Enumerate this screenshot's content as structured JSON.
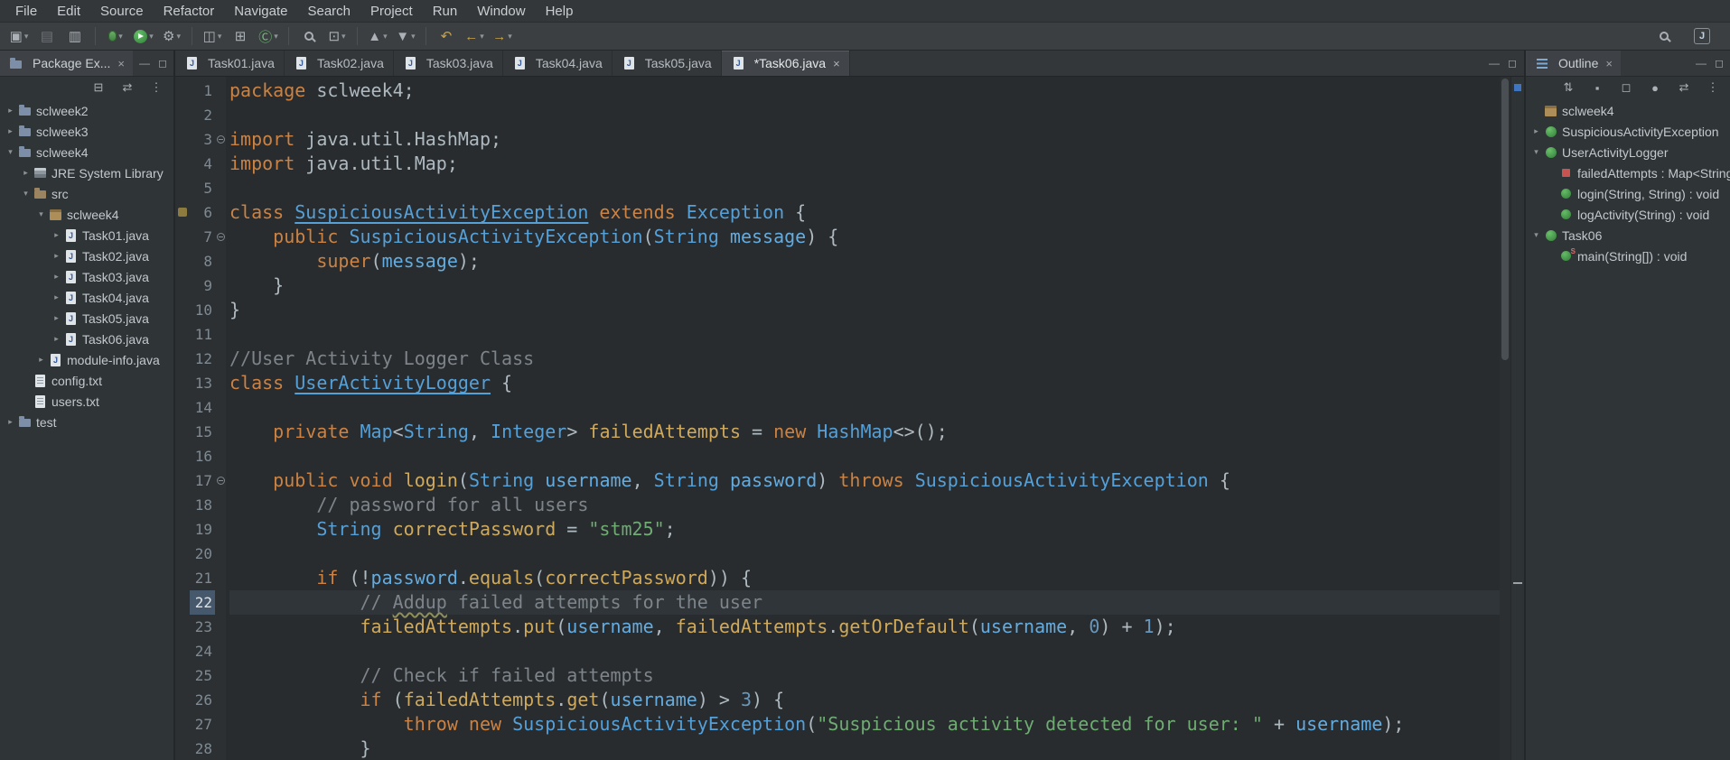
{
  "glyphs": {
    "close": "×",
    "min": "—",
    "max": "◻",
    "dropdown": "▾",
    "arrow_collapsed": "▸",
    "arrow_expanded": "▾"
  },
  "colors": {
    "editor_bg": "#282C2F",
    "keyword": "#CC8242",
    "type": "#56A0D8",
    "member": "#CFA95C",
    "string": "#6FAC72",
    "comment": "#7D848A",
    "number": "#6897BB",
    "current_line_number_bg": "#46586B"
  },
  "menubar": {
    "items": [
      "File",
      "Edit",
      "Source",
      "Refactor",
      "Navigate",
      "Search",
      "Project",
      "Run",
      "Window",
      "Help"
    ]
  },
  "toolbar": {
    "icons": [
      {
        "name": "new-wizard-icon",
        "glyph": "▣",
        "dropdown": true
      },
      {
        "name": "save-icon",
        "glyph": "▤",
        "dim": true
      },
      {
        "name": "print-icon",
        "glyph": "▥"
      },
      {
        "sep": true
      },
      {
        "name": "debug-icon",
        "special": "bug",
        "dropdown": true
      },
      {
        "name": "run-icon",
        "special": "run",
        "dropdown": true
      },
      {
        "name": "external-tools-icon",
        "glyph": "⚙",
        "dropdown": true
      },
      {
        "sep": true
      },
      {
        "name": "new-java-project-icon",
        "glyph": "◫",
        "dropdown": true
      },
      {
        "name": "new-package-icon",
        "glyph": "⊞"
      },
      {
        "name": "new-class-icon",
        "glyph": "Ⓒ",
        "color": "#6FBF73",
        "dropdown": true
      },
      {
        "sep": true
      },
      {
        "name": "search-flashlight-icon",
        "special": "mag"
      },
      {
        "name": "open-task-icon",
        "glyph": "⊡",
        "dropdown": true
      },
      {
        "sep": true
      },
      {
        "name": "previous-annotation-icon",
        "glyph": "▲",
        "dropdown": true
      },
      {
        "name": "next-annotation-icon",
        "glyph": "▼",
        "dropdown": true
      },
      {
        "sep": true
      },
      {
        "name": "last-edit-location-icon",
        "glyph": "↶",
        "color": "#C9A348"
      },
      {
        "name": "back-icon",
        "glyph": "←",
        "color": "#C9A348",
        "dropdown": true
      },
      {
        "name": "forward-icon",
        "glyph": "→",
        "color": "#C9A348",
        "dropdown": true
      }
    ],
    "right_icons": [
      {
        "name": "search-icon",
        "special": "mag"
      },
      {
        "name": "java-perspective-icon",
        "glyph": "J",
        "boxed": true
      }
    ]
  },
  "package_explorer": {
    "tab_label": "Package Ex...",
    "toolbar_icons": [
      {
        "name": "collapse-all-icon",
        "glyph": "⊟"
      },
      {
        "name": "link-with-editor-icon",
        "glyph": "⇄"
      },
      {
        "name": "view-menu-icon",
        "glyph": "⋮"
      }
    ],
    "tree": [
      {
        "label": "sclweek2",
        "depth": 0,
        "icon": "project",
        "arrow": "right"
      },
      {
        "label": "sclweek3",
        "depth": 0,
        "icon": "project",
        "arrow": "right"
      },
      {
        "label": "sclweek4",
        "depth": 0,
        "icon": "project",
        "arrow": "down"
      },
      {
        "label": "JRE System Library",
        "depth": 1,
        "icon": "jre",
        "arrow": "right"
      },
      {
        "label": "src",
        "depth": 1,
        "icon": "srcfolder",
        "arrow": "down"
      },
      {
        "label": "sclweek4",
        "depth": 2,
        "icon": "package",
        "arrow": "down"
      },
      {
        "label": "Task01.java",
        "depth": 3,
        "icon": "jfile",
        "arrow": "right"
      },
      {
        "label": "Task02.java",
        "depth": 3,
        "icon": "jfile",
        "arrow": "right"
      },
      {
        "label": "Task03.java",
        "depth": 3,
        "icon": "jfile",
        "arrow": "right"
      },
      {
        "label": "Task04.java",
        "depth": 3,
        "icon": "jfile",
        "arrow": "right"
      },
      {
        "label": "Task05.java",
        "depth": 3,
        "icon": "jfile",
        "arrow": "right"
      },
      {
        "label": "Task06.java",
        "depth": 3,
        "icon": "jfile",
        "arrow": "right"
      },
      {
        "label": "module-info.java",
        "depth": 2,
        "icon": "jfile",
        "arrow": "right"
      },
      {
        "label": "config.txt",
        "depth": 1,
        "icon": "txt"
      },
      {
        "label": "users.txt",
        "depth": 1,
        "icon": "txt"
      },
      {
        "label": "test",
        "depth": 0,
        "icon": "project",
        "arrow": "right"
      }
    ]
  },
  "editor": {
    "tabs": [
      {
        "label": "Task01.java"
      },
      {
        "label": "Task02.java"
      },
      {
        "label": "Task03.java"
      },
      {
        "label": "Task04.java"
      },
      {
        "label": "Task05.java"
      },
      {
        "label": "Task06.java",
        "active": true,
        "dirty": true
      }
    ],
    "lines": [
      {
        "n": 1,
        "t": [
          [
            "kw",
            "package"
          ],
          [
            "pl",
            " sclweek4;"
          ]
        ]
      },
      {
        "n": 2,
        "t": []
      },
      {
        "n": 3,
        "fold": true,
        "t": [
          [
            "kw",
            "import"
          ],
          [
            "pl",
            " java.util.HashMap;"
          ]
        ]
      },
      {
        "n": 4,
        "t": [
          [
            "kw",
            "import"
          ],
          [
            "pl",
            " java.util.Map;"
          ]
        ]
      },
      {
        "n": 5,
        "t": []
      },
      {
        "n": 6,
        "marker": true,
        "t": [
          [
            "kw",
            "class"
          ],
          [
            "pl",
            " "
          ],
          [
            "tyu",
            "SuspiciousActivityException"
          ],
          [
            "pl",
            " "
          ],
          [
            "kw",
            "extends"
          ],
          [
            "pl",
            " "
          ],
          [
            "ty",
            "Exception"
          ],
          [
            "pl",
            " {"
          ]
        ]
      },
      {
        "n": 7,
        "fold": true,
        "t": [
          [
            "pl",
            "\t"
          ],
          [
            "kw",
            "public"
          ],
          [
            "pl",
            " "
          ],
          [
            "ty",
            "SuspiciousActivityException"
          ],
          [
            "pl",
            "("
          ],
          [
            "ty",
            "String"
          ],
          [
            "pl",
            " "
          ],
          [
            "va",
            "message"
          ],
          [
            "pl",
            ") {"
          ]
        ]
      },
      {
        "n": 8,
        "t": [
          [
            "pl",
            "\t\t"
          ],
          [
            "kw",
            "super"
          ],
          [
            "pl",
            "("
          ],
          [
            "va",
            "message"
          ],
          [
            "pl",
            ");"
          ]
        ]
      },
      {
        "n": 9,
        "t": [
          [
            "pl",
            "\t}"
          ]
        ]
      },
      {
        "n": 10,
        "t": [
          [
            "pl",
            "}"
          ]
        ]
      },
      {
        "n": 11,
        "t": []
      },
      {
        "n": 12,
        "t": [
          [
            "co",
            "//User Activity Logger Class"
          ]
        ]
      },
      {
        "n": 13,
        "t": [
          [
            "kw",
            "class"
          ],
          [
            "pl",
            " "
          ],
          [
            "tyu",
            "UserActivityLogger"
          ],
          [
            "pl",
            " {"
          ]
        ]
      },
      {
        "n": 14,
        "t": []
      },
      {
        "n": 15,
        "t": [
          [
            "pl",
            "\t"
          ],
          [
            "kw",
            "private"
          ],
          [
            "pl",
            " "
          ],
          [
            "ty",
            "Map"
          ],
          [
            "pl",
            "<"
          ],
          [
            "ty",
            "String"
          ],
          [
            "pl",
            ", "
          ],
          [
            "ty",
            "Integer"
          ],
          [
            "pl",
            "> "
          ],
          [
            "me",
            "failedAttempts"
          ],
          [
            "pl",
            " = "
          ],
          [
            "kw",
            "new"
          ],
          [
            "pl",
            " "
          ],
          [
            "ty",
            "HashMap"
          ],
          [
            "pl",
            "<>();"
          ]
        ]
      },
      {
        "n": 16,
        "t": []
      },
      {
        "n": 17,
        "fold": true,
        "t": [
          [
            "pl",
            "\t"
          ],
          [
            "kw",
            "public"
          ],
          [
            "pl",
            " "
          ],
          [
            "kw",
            "void"
          ],
          [
            "pl",
            " "
          ],
          [
            "me",
            "login"
          ],
          [
            "pl",
            "("
          ],
          [
            "ty",
            "String"
          ],
          [
            "pl",
            " "
          ],
          [
            "va",
            "username"
          ],
          [
            "pl",
            ", "
          ],
          [
            "ty",
            "String"
          ],
          [
            "pl",
            " "
          ],
          [
            "va",
            "password"
          ],
          [
            "pl",
            ") "
          ],
          [
            "kw",
            "throws"
          ],
          [
            "pl",
            " "
          ],
          [
            "ty",
            "SuspiciousActivityException"
          ],
          [
            "pl",
            " {"
          ]
        ]
      },
      {
        "n": 18,
        "t": [
          [
            "pl",
            "\t\t"
          ],
          [
            "co",
            "// password for all users"
          ]
        ]
      },
      {
        "n": 19,
        "t": [
          [
            "pl",
            "\t\t"
          ],
          [
            "ty",
            "String"
          ],
          [
            "pl",
            " "
          ],
          [
            "me",
            "correctPassword"
          ],
          [
            "pl",
            " = "
          ],
          [
            "st",
            "\"stm25\""
          ],
          [
            "pl",
            ";"
          ]
        ]
      },
      {
        "n": 20,
        "t": []
      },
      {
        "n": 21,
        "t": [
          [
            "pl",
            "\t\t"
          ],
          [
            "kw",
            "if"
          ],
          [
            "pl",
            " (!"
          ],
          [
            "va",
            "password"
          ],
          [
            "pl",
            "."
          ],
          [
            "me",
            "equals"
          ],
          [
            "pl",
            "("
          ],
          [
            "me",
            "correctPassword"
          ],
          [
            "pl",
            ")) {"
          ]
        ]
      },
      {
        "n": 22,
        "cur": true,
        "t": [
          [
            "pl",
            "\t\t\t"
          ],
          [
            "co",
            "// "
          ],
          [
            "cow",
            "Addup"
          ],
          [
            "co",
            " failed attempts for the user"
          ]
        ]
      },
      {
        "n": 23,
        "t": [
          [
            "pl",
            "\t\t\t"
          ],
          [
            "me",
            "failedAttempts"
          ],
          [
            "pl",
            "."
          ],
          [
            "me",
            "put"
          ],
          [
            "pl",
            "("
          ],
          [
            "va",
            "username"
          ],
          [
            "pl",
            ", "
          ],
          [
            "me",
            "failedAttempts"
          ],
          [
            "pl",
            "."
          ],
          [
            "me",
            "getOrDefault"
          ],
          [
            "pl",
            "("
          ],
          [
            "va",
            "username"
          ],
          [
            "pl",
            ", "
          ],
          [
            "nu",
            "0"
          ],
          [
            "pl",
            ") + "
          ],
          [
            "nu",
            "1"
          ],
          [
            "pl",
            ");"
          ]
        ]
      },
      {
        "n": 24,
        "t": []
      },
      {
        "n": 25,
        "t": [
          [
            "pl",
            "\t\t\t"
          ],
          [
            "co",
            "// Check if failed attempts"
          ]
        ]
      },
      {
        "n": 26,
        "t": [
          [
            "pl",
            "\t\t\t"
          ],
          [
            "kw",
            "if"
          ],
          [
            "pl",
            " ("
          ],
          [
            "me",
            "failedAttempts"
          ],
          [
            "pl",
            "."
          ],
          [
            "me",
            "get"
          ],
          [
            "pl",
            "("
          ],
          [
            "va",
            "username"
          ],
          [
            "pl",
            ") > "
          ],
          [
            "nu",
            "3"
          ],
          [
            "pl",
            ") {"
          ]
        ]
      },
      {
        "n": 27,
        "t": [
          [
            "pl",
            "\t\t\t\t"
          ],
          [
            "kw",
            "throw"
          ],
          [
            "pl",
            " "
          ],
          [
            "kw",
            "new"
          ],
          [
            "pl",
            " "
          ],
          [
            "ty",
            "SuspiciousActivityException"
          ],
          [
            "pl",
            "("
          ],
          [
            "st",
            "\"Suspicious activity detected for user: \""
          ],
          [
            "pl",
            " + "
          ],
          [
            "va",
            "username"
          ],
          [
            "pl",
            ");"
          ]
        ]
      },
      {
        "n": 28,
        "t": [
          [
            "pl",
            "\t\t\t}"
          ]
        ]
      }
    ]
  },
  "outline": {
    "tab_label": "Outline",
    "toolbar_icons": [
      {
        "name": "sort-icon",
        "glyph": "⇅"
      },
      {
        "name": "hide-fields-icon",
        "glyph": "▪"
      },
      {
        "name": "hide-static-members-icon",
        "glyph": "◻"
      },
      {
        "name": "hide-non-public-members-icon",
        "glyph": "●"
      },
      {
        "name": "link-with-editor-icon",
        "glyph": "⇄"
      },
      {
        "name": "view-menu-icon",
        "glyph": "⋮"
      }
    ],
    "tree": [
      {
        "label": "sclweek4",
        "depth": 0,
        "icon": "package"
      },
      {
        "label": "SuspiciousActivityException",
        "depth": 0,
        "icon": "class",
        "arrow": "right"
      },
      {
        "label": "UserActivityLogger",
        "depth": 0,
        "icon": "class",
        "arrow": "down"
      },
      {
        "label": "failedAttempts : Map<String, Integer>",
        "depth": 1,
        "icon": "field"
      },
      {
        "label": "login(String, String) : void",
        "depth": 1,
        "icon": "method"
      },
      {
        "label": "logActivity(String) : void",
        "depth": 1,
        "icon": "method"
      },
      {
        "label": "Task06",
        "depth": 0,
        "icon": "class",
        "arrow": "down"
      },
      {
        "label": "main(String[]) : void",
        "depth": 1,
        "icon": "methodstatic"
      }
    ]
  }
}
